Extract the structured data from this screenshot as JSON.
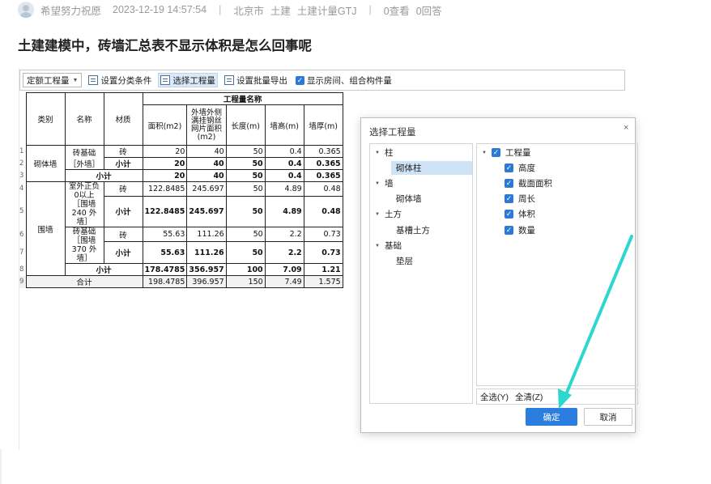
{
  "post": {
    "author": "希望努力祝愿",
    "timestamp": "2023-12-19 14:57:54",
    "separator": "|",
    "location": "北京市",
    "category": "土建",
    "tag": "土建计量GTJ",
    "views": "0查看",
    "answers": "0回答",
    "title": "土建建模中，砖墙汇总表不显示体积是怎么回事呢"
  },
  "toolbar": {
    "mode_select": "定额工程量",
    "btn_category": "设置分类条件",
    "btn_select_qty": "选择工程量",
    "btn_batch_export": "设置批量导出",
    "chk_show_room": "显示房间、组合构件量"
  },
  "table": {
    "head_category": "类别",
    "head_name": "名称",
    "head_material": "材质",
    "head_group": "工程量名称",
    "columns": [
      "面积(m2)",
      "外墙外侧满挂钢丝网片面积(m2)",
      "长度(m)",
      "墙高(m)",
      "墙厚(m)"
    ],
    "rows": [
      {
        "no": "1",
        "category": "砌体墙",
        "name": "砖基础［外墙］",
        "material": "砖",
        "v": [
          "20",
          "40",
          "50",
          "0.4",
          "0.365"
        ]
      },
      {
        "no": "2",
        "material": "小计",
        "v": [
          "20",
          "40",
          "50",
          "0.4",
          "0.365"
        ]
      },
      {
        "no": "3",
        "label": "小计",
        "v": [
          "20",
          "40",
          "50",
          "0.4",
          "0.365"
        ]
      },
      {
        "no": "4",
        "category": "围墙",
        "name": "室外正负0以上［围墙 240 外墙］",
        "material": "砖",
        "v": [
          "122.8485",
          "245.697",
          "50",
          "4.89",
          "0.48"
        ]
      },
      {
        "no": "5",
        "material": "小计",
        "v": [
          "122.8485",
          "245.697",
          "50",
          "4.89",
          "0.48"
        ]
      },
      {
        "no": "6",
        "name": "砖基础［围墙 370 外墙］",
        "material": "砖",
        "v": [
          "55.63",
          "111.26",
          "50",
          "2.2",
          "0.73"
        ]
      },
      {
        "no": "7",
        "material": "小计",
        "v": [
          "55.63",
          "111.26",
          "50",
          "2.2",
          "0.73"
        ]
      },
      {
        "no": "8",
        "label": "小计",
        "v": [
          "178.4785",
          "356.957",
          "100",
          "7.09",
          "1.21"
        ]
      },
      {
        "no": "9",
        "label": "合计",
        "v": [
          "198.4785",
          "396.957",
          "150",
          "7.49",
          "1.575"
        ]
      }
    ]
  },
  "dialog": {
    "title": "选择工程量",
    "close": "×",
    "tree": [
      {
        "label": "柱",
        "children": [
          "砌体柱"
        ]
      },
      {
        "label": "墙",
        "children": [
          "砌体墙"
        ]
      },
      {
        "label": "土方",
        "children": [
          "基槽土方"
        ]
      },
      {
        "label": "基础",
        "children": [
          "垫层"
        ]
      }
    ],
    "root_check": "工程量",
    "checks": [
      "高度",
      "截面面积",
      "周长",
      "体积",
      "数量"
    ],
    "select_all": "全选(Y)",
    "clear_all": "全清(Z)",
    "ok": "确定",
    "cancel": "取消"
  },
  "colors": {
    "accent": "#2b7de0",
    "annotation_arrow": "#2ed6d0"
  }
}
